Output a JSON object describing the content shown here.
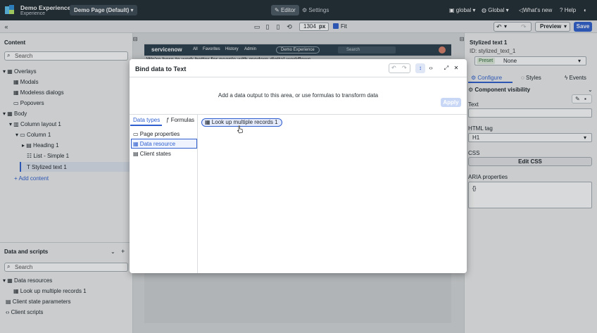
{
  "header": {
    "app_title": "Demo Experience",
    "app_subtitle": "Experience",
    "page_select": "Demo Page (Default)",
    "editor_label": "Editor",
    "settings_label": "Settings",
    "scope_label": "global",
    "global_label": "Global",
    "whats_new_label": "What's new",
    "help_label": "Help"
  },
  "toolbar": {
    "width_value": "1304",
    "width_unit": "px",
    "fit_label": "Fit",
    "preview_label": "Preview",
    "save_label": "Save"
  },
  "left_panel": {
    "content_title": "Content",
    "search_placeholder": "Search",
    "tree": [
      {
        "label": "Overlays"
      },
      {
        "label": "Modals"
      },
      {
        "label": "Modeless dialogs"
      },
      {
        "label": "Popovers"
      },
      {
        "label": "Body"
      },
      {
        "label": "Column layout 1"
      },
      {
        "label": "Column 1"
      },
      {
        "label": "Heading 1"
      },
      {
        "label": "List - Simple 1"
      },
      {
        "label": "Stylized text 1"
      }
    ],
    "add_content": "Add content",
    "data_title": "Data and scripts",
    "data_search_placeholder": "Search",
    "data_tree": [
      {
        "label": "Data resources"
      },
      {
        "label": "Look up multiple records 1"
      },
      {
        "label": "Client state parameters"
      },
      {
        "label": "Client scripts"
      }
    ]
  },
  "canvas": {
    "brand": "servicenow",
    "nav": [
      "All",
      "Favorites",
      "History",
      "Admin"
    ],
    "demo_pill": "Demo Experience",
    "search_placeholder": "Search",
    "text_fragment": "We're here to work better for people with modern digital workflows"
  },
  "right_panel": {
    "title": "Stylized text 1",
    "id_line": "ID: stylized_text_1",
    "preset_label": "Preset",
    "preset_value": "None",
    "tabs": [
      "Configure",
      "Styles",
      "Events"
    ],
    "visibility_label": "Component visibility",
    "text_label": "Text",
    "html_tag_label": "HTML tag",
    "html_tag_value": "H1",
    "css_label": "CSS",
    "edit_css_label": "Edit CSS",
    "aria_label": "ARIA properties",
    "aria_value": "{}"
  },
  "modal": {
    "title": "Bind data to Text",
    "description": "Add a data output to this area, or use formulas to transform data",
    "apply_label": "Apply",
    "tab_data_types": "Data types",
    "tab_formulas": "Formulas",
    "items": [
      "Page properties",
      "Data resource",
      "Client states"
    ],
    "pill_label": "Look up multiple records 1"
  }
}
